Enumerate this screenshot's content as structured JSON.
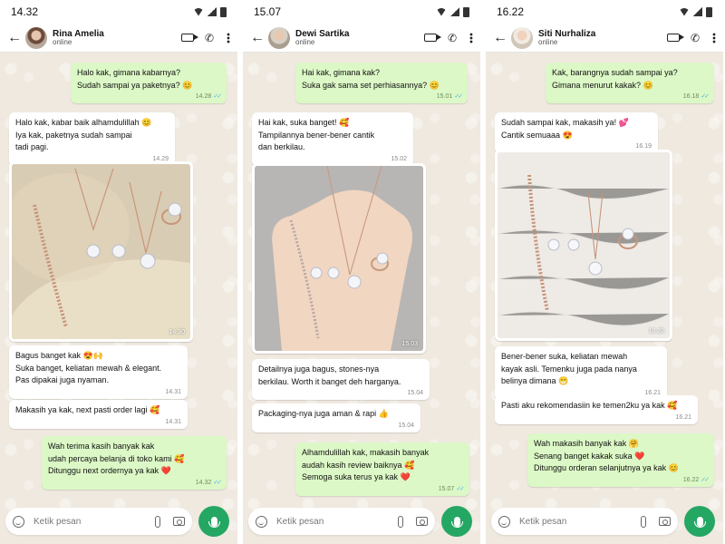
{
  "screens": [
    {
      "time": "14.32",
      "contact": "Rina Amelia",
      "status": "online",
      "messages": [
        {
          "text": "Halo kak, gimana kabarnya?\nSudah sampai ya paketnya? 😊",
          "time": "14.28"
        },
        {
          "text": "Halo kak, kabar baik alhamdulillah 😊\nIya kak, paketnya sudah sampai\ntadi pagi.",
          "time": "14.29"
        },
        {
          "text": "",
          "time": "14.30"
        },
        {
          "text": "Bagus banget kak 😍🙌\nSuka banget, keliatan mewah & elegant.\nPas dipakai juga nyaman.",
          "time": "14.31"
        },
        {
          "text": "Makasih ya kak, next pasti order lagi 🥰",
          "time": "14.31"
        },
        {
          "text": "Wah terima kasih banyak kak\nudah percaya belanja di toko kami 🥰\nDitunggu next ordernya ya kak ❤️",
          "time": "14.32"
        }
      ],
      "input_placeholder": "Ketik pesan"
    },
    {
      "time": "15.07",
      "contact": "Dewi Sartika",
      "status": "online",
      "messages": [
        {
          "text": "Hai kak, gimana kak?\nSuka gak sama set perhiasannya? 😊",
          "time": "15.01"
        },
        {
          "text": "Hai kak, suka banget! 🥰\nTampilannya bener-bener cantik\ndan berkilau.",
          "time": "15.02"
        },
        {
          "text": "",
          "time": "15.03"
        },
        {
          "text": "Detailnya juga bagus, stones-nya\nberkilau. Worth it banget deh harganya.",
          "time": "15.04"
        },
        {
          "text": "Packaging-nya juga aman & rapi 👍",
          "time": "15.04"
        },
        {
          "text": "Alhamdulillah kak, makasih banyak\naudah kasih review baiknya 🥰\nSemoga suka terus ya kak ❤️",
          "time": "15.07"
        }
      ],
      "input_placeholder": "Ketik pesan"
    },
    {
      "time": "16.22",
      "contact": "Siti Nurhaliza",
      "status": "online",
      "messages": [
        {
          "text": "Kak, barangnya sudah sampai ya?\nGimana menurut kakak? 😊",
          "time": "16.18"
        },
        {
          "text": "Sudah sampai kak, makasih ya! 💕\nCantik semuaaa 😍",
          "time": "16.19"
        },
        {
          "text": "",
          "time": "16.20"
        },
        {
          "text": "Bener-bener suka, keliatan mewah\nkayak asli. Temenku juga pada nanya\nbelinya dimana 😁",
          "time": "16.21"
        },
        {
          "text": "Pasti aku rekomendasiin ke temen2ku ya kak 🥰",
          "time": "16.21"
        },
        {
          "text": "Wah makasih banyak kak 🤗\nSenang banget kakak suka ❤️\nDitunggu orderan selanjutnya ya kak 😊",
          "time": "16.22"
        }
      ],
      "input_placeholder": "Ketik pesan"
    }
  ],
  "colors": {
    "outgoing": "#dcf8c6",
    "incoming": "#ffffff",
    "mic": "#25a764",
    "read_ticks": "#4fb6ec"
  }
}
